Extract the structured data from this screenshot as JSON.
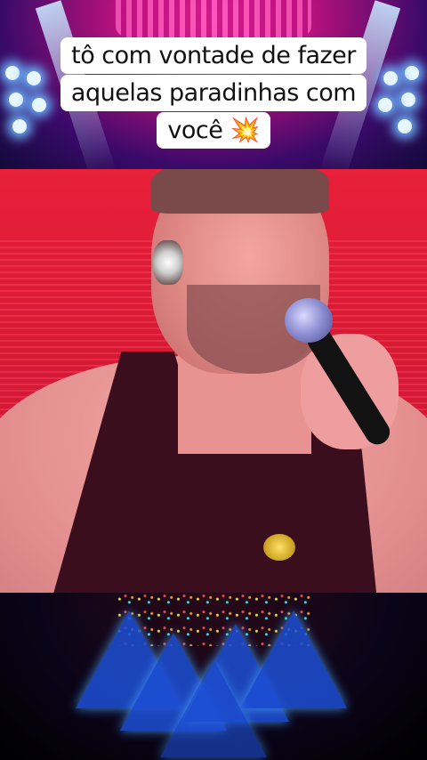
{
  "caption": {
    "lines": [
      "tô com vontade de fazer",
      "aquelas paradinhas com",
      "você 💥"
    ]
  },
  "colors": {
    "stage_pink": "#ff3aa8",
    "stage_purple": "#3a0a6a",
    "background_red": "#d81a34",
    "tank_top": "#3a0e1c",
    "bottom_light_blue": "#1d4fd6"
  },
  "scene": {
    "top_band": "stage lights with pink curtain",
    "middle_band": "singer with microphone on red background",
    "bottom_band": "blue triangular stage lights with sparkles"
  }
}
